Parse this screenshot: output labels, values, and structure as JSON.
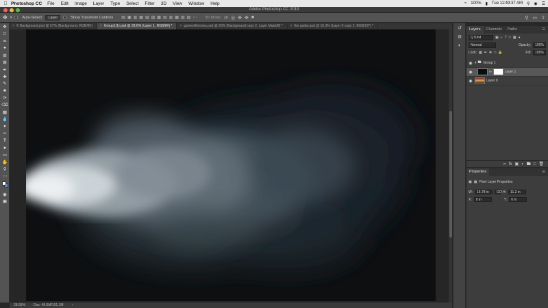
{
  "menubar": {
    "app": "Photoshop CC",
    "items": [
      "File",
      "Edit",
      "Image",
      "Layer",
      "Type",
      "Select",
      "Filter",
      "3D",
      "View",
      "Window",
      "Help"
    ],
    "battery": "100%",
    "clock": "Tue 11:49:37 AM"
  },
  "window": {
    "title": "Adobe Photoshop CC 2019"
  },
  "options": {
    "auto_select_label": "Auto-Select:",
    "auto_select_value": "Layer",
    "transform_label": "Show Transform Controls",
    "mode_label": "3D Mode:"
  },
  "tabs": [
    {
      "label": "© Background.psd @ 57% (Background, RGB/8#)",
      "active": false
    },
    {
      "label": "Group1(1).psd @ 28.6% (Layer 1, RGB/8#) *",
      "active": true
    },
    {
      "label": "gameofthrones.psd @ 20% (Background copy 2, Layer Mask/8) *",
      "active": false
    },
    {
      "label": "fire guitar.psd @ 16.3% (Layer 0 copy 2, RGB/16*) *",
      "active": false
    }
  ],
  "status": {
    "zoom": "28.55%",
    "doc": "Doc: 48.6M/101.1M"
  },
  "layers_panel": {
    "tabs": [
      "Layers",
      "Channels",
      "Paths"
    ],
    "filter": "Q Kind",
    "blend_mode": "Normal",
    "opacity_label": "Opacity:",
    "opacity": "100%",
    "lock_label": "Lock:",
    "fill_label": "Fill:",
    "fill": "100%",
    "layers": [
      {
        "name": "Group 1",
        "type": "group",
        "selected": false
      },
      {
        "name": "Layer 1",
        "type": "layer-mask",
        "selected": true
      },
      {
        "name": "Layer 0",
        "type": "layer",
        "selected": false
      }
    ]
  },
  "properties": {
    "title": "Properties",
    "subtitle": "Pixel Layer Properties",
    "w_label": "W:",
    "w": "15.78 in",
    "go_label": "GO",
    "h_label": "H:",
    "h": "11.2 in",
    "x_label": "X:",
    "x": "0 in",
    "y_label": "Y:",
    "y": "0 in"
  },
  "colors": {
    "canvas": "#0d0f11",
    "panel": "#3d3d3d",
    "toolbar": "#535353",
    "accent": "#1473e6"
  }
}
